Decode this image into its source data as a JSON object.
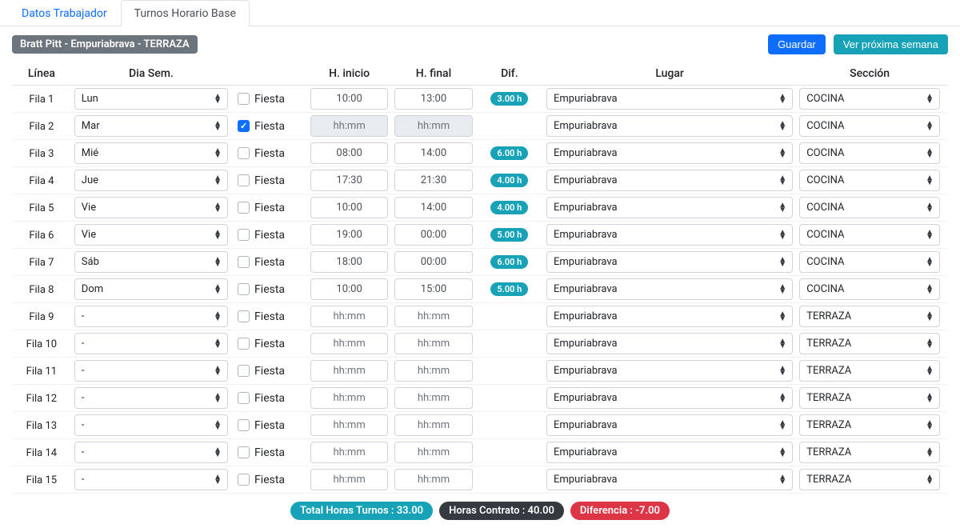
{
  "tabs": {
    "datos": "Datos Trabajador",
    "turnos": "Turnos Horario Base"
  },
  "worker_badge": "Bratt Pitt - Empuriabrava - TERRAZA",
  "buttons": {
    "guardar": "Guardar",
    "proxima": "Ver próxima semana"
  },
  "headers": {
    "linea": "Línea",
    "dia": "Dia Sem.",
    "fiesta": "",
    "inicio": "H. inicio",
    "final": "H. final",
    "dif": "Dif.",
    "lugar": "Lugar",
    "seccion": "Sección"
  },
  "fiesta_label": "Fiesta",
  "time_placeholder": "hh:mm",
  "rows": [
    {
      "linea": "Fila 1",
      "dia": "Lun",
      "fiesta": false,
      "inicio": "10:00",
      "final": "13:00",
      "dif": "3.00 h",
      "lugar": "Empuriabrava",
      "seccion": "COCINA"
    },
    {
      "linea": "Fila 2",
      "dia": "Mar",
      "fiesta": true,
      "inicio": "",
      "final": "",
      "dif": "",
      "lugar": "Empuriabrava",
      "seccion": "COCINA",
      "disabled": true
    },
    {
      "linea": "Fila 3",
      "dia": "Mié",
      "fiesta": false,
      "inicio": "08:00",
      "final": "14:00",
      "dif": "6.00 h",
      "lugar": "Empuriabrava",
      "seccion": "COCINA"
    },
    {
      "linea": "Fila 4",
      "dia": "Jue",
      "fiesta": false,
      "inicio": "17:30",
      "final": "21:30",
      "dif": "4.00 h",
      "lugar": "Empuriabrava",
      "seccion": "COCINA"
    },
    {
      "linea": "Fila 5",
      "dia": "Vie",
      "fiesta": false,
      "inicio": "10:00",
      "final": "14:00",
      "dif": "4.00 h",
      "lugar": "Empuriabrava",
      "seccion": "COCINA"
    },
    {
      "linea": "Fila 6",
      "dia": "Vie",
      "fiesta": false,
      "inicio": "19:00",
      "final": "00:00",
      "dif": "5.00 h",
      "lugar": "Empuriabrava",
      "seccion": "COCINA"
    },
    {
      "linea": "Fila 7",
      "dia": "Sáb",
      "fiesta": false,
      "inicio": "18:00",
      "final": "00:00",
      "dif": "6.00 h",
      "lugar": "Empuriabrava",
      "seccion": "COCINA"
    },
    {
      "linea": "Fila 8",
      "dia": "Dom",
      "fiesta": false,
      "inicio": "10:00",
      "final": "15:00",
      "dif": "5.00 h",
      "lugar": "Empuriabrava",
      "seccion": "COCINA"
    },
    {
      "linea": "Fila 9",
      "dia": "-",
      "fiesta": false,
      "inicio": "",
      "final": "",
      "dif": "",
      "lugar": "Empuriabrava",
      "seccion": "TERRAZA"
    },
    {
      "linea": "Fila 10",
      "dia": "-",
      "fiesta": false,
      "inicio": "",
      "final": "",
      "dif": "",
      "lugar": "Empuriabrava",
      "seccion": "TERRAZA"
    },
    {
      "linea": "Fila 11",
      "dia": "-",
      "fiesta": false,
      "inicio": "",
      "final": "",
      "dif": "",
      "lugar": "Empuriabrava",
      "seccion": "TERRAZA"
    },
    {
      "linea": "Fila 12",
      "dia": "-",
      "fiesta": false,
      "inicio": "",
      "final": "",
      "dif": "",
      "lugar": "Empuriabrava",
      "seccion": "TERRAZA"
    },
    {
      "linea": "Fila 13",
      "dia": "-",
      "fiesta": false,
      "inicio": "",
      "final": "",
      "dif": "",
      "lugar": "Empuriabrava",
      "seccion": "TERRAZA"
    },
    {
      "linea": "Fila 14",
      "dia": "-",
      "fiesta": false,
      "inicio": "",
      "final": "",
      "dif": "",
      "lugar": "Empuriabrava",
      "seccion": "TERRAZA"
    },
    {
      "linea": "Fila 15",
      "dia": "-",
      "fiesta": false,
      "inicio": "",
      "final": "",
      "dif": "",
      "lugar": "Empuriabrava",
      "seccion": "TERRAZA"
    }
  ],
  "summary": {
    "total": "Total Horas Turnos : 33.00",
    "contrato": "Horas Contrato : 40.00",
    "diferencia": "Diferencia : -7.00"
  }
}
